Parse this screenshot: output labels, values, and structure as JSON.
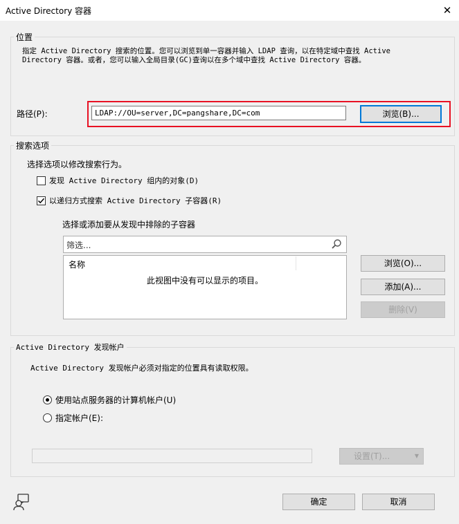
{
  "window": {
    "title": "Active Directory 容器",
    "close_glyph": "✕"
  },
  "location": {
    "group_title": "位置",
    "description_line1": "指定 Active Directory 搜索的位置。您可以浏览到单一容器并输入 LDAP 查询，以在特定域中查找 Active",
    "description_line2": "Directory 容器。或者，您可以输入全局目录(GC)查询以在多个域中查找 Active Directory 容器。",
    "path_label": "路径(P):",
    "path_value": "LDAP://OU=server,DC=pangshare,DC=com",
    "browse_label": "浏览(B)...",
    "highlight_color": "#e81123"
  },
  "search_options": {
    "group_title": "搜索选项",
    "instruction": "选择选项以修改搜索行为。",
    "discover_group_objects": {
      "label": "发现 Active Directory 组内的对象(D)",
      "checked": false
    },
    "recursive_search": {
      "label": "以递归方式搜索 Active Directory 子容器(R)",
      "checked": true
    },
    "exclude_label": "选择或添加要从发现中排除的子容器",
    "filter_placeholder": "筛选...",
    "list_column": "名称",
    "empty_text": "此视图中没有可以显示的项目。",
    "browse_label": "浏览(O)...",
    "add_label": "添加(A)...",
    "delete_label": "删除(V)"
  },
  "account": {
    "group_title": "Active Directory 发现帐户",
    "description": "Active Directory 发现帐户必须对指定的位置具有读取权限。",
    "use_computer_account": {
      "label": "使用站点服务器的计算机帐户(U)",
      "selected": true
    },
    "specify_account": {
      "label": "指定帐户(E):",
      "selected": false
    },
    "account_value": "",
    "settings_label": "设置(T)..."
  },
  "footer": {
    "ok_label": "确定",
    "cancel_label": "取消"
  }
}
